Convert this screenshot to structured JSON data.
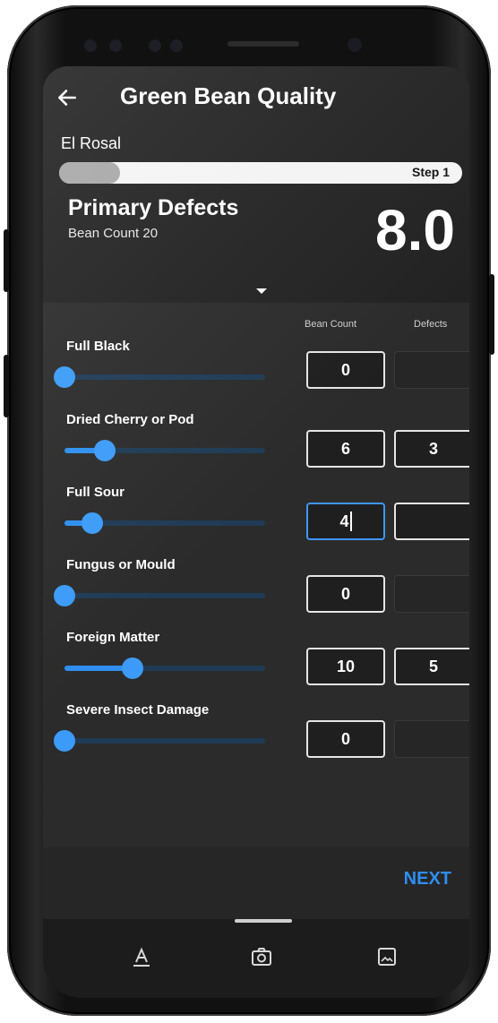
{
  "app": {
    "title": "Green Bean Quality",
    "farm_name": "El Rosal"
  },
  "progress": {
    "step_label": "Step 1",
    "fill_fraction": 0.15
  },
  "section": {
    "title": "Primary Defects",
    "subtitle": "Bean Count 20",
    "score": "8.0"
  },
  "columns": {
    "bean_count": "Bean Count",
    "defects": "Defects"
  },
  "defects": [
    {
      "label": "Full Black",
      "bean_count": "0",
      "defects": "",
      "slider_fraction": 0.0,
      "active": false
    },
    {
      "label": "Dried Cherry or Pod",
      "bean_count": "6",
      "defects": "3",
      "slider_fraction": 0.2,
      "active": false
    },
    {
      "label": "Full Sour",
      "bean_count": "4",
      "defects": "",
      "slider_fraction": 0.14,
      "active": true
    },
    {
      "label": "Fungus or Mould",
      "bean_count": "0",
      "defects": "",
      "slider_fraction": 0.0,
      "active": false
    },
    {
      "label": "Foreign Matter",
      "bean_count": "10",
      "defects": "5",
      "slider_fraction": 0.34,
      "active": false
    },
    {
      "label": "Severe Insect Damage",
      "bean_count": "0",
      "defects": "",
      "slider_fraction": 0.0,
      "active": false
    }
  ],
  "footer": {
    "next_label": "NEXT"
  },
  "toolbar": {
    "icons": [
      "text-format-icon",
      "camera-icon",
      "image-icon"
    ]
  },
  "colors": {
    "accent": "#2f8ef0",
    "background": "#2b2b2b"
  }
}
